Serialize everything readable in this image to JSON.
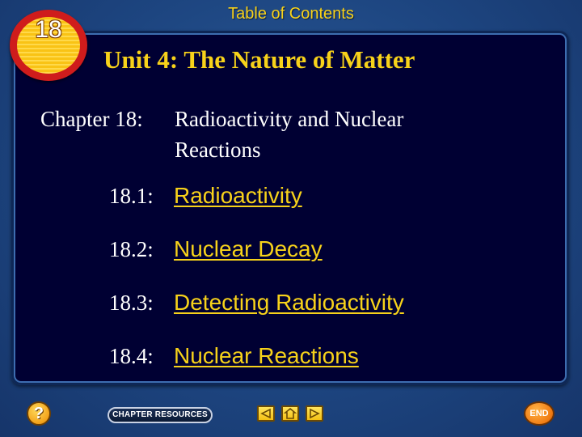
{
  "header": {
    "title": "Table of Contents"
  },
  "badge": {
    "chapter_number": "18"
  },
  "unit": {
    "title": "Unit 4: The Nature of Matter"
  },
  "chapter": {
    "label": "Chapter 18:",
    "name": "Radioactivity and Nuclear Reactions"
  },
  "sections": [
    {
      "number": "18.1:",
      "title": "Radioactivity"
    },
    {
      "number": "18.2:",
      "title": "Nuclear Decay"
    },
    {
      "number": "18.3:",
      "title": "Detecting Radioactivity"
    },
    {
      "number": "18.4:",
      "title": "Nuclear Reactions"
    }
  ],
  "footer": {
    "help_label": "?",
    "chapter_resources_label": "CHAPTER RESOURCES",
    "end_label": "END",
    "icons": {
      "prev": "triangle-left-icon",
      "home": "home-icon",
      "next": "triangle-right-icon"
    }
  },
  "colors": {
    "accent_yellow": "#f7d21a",
    "panel_bg": "#000033",
    "page_bg": "#1d4580",
    "badge_red": "#cf1c1c"
  }
}
